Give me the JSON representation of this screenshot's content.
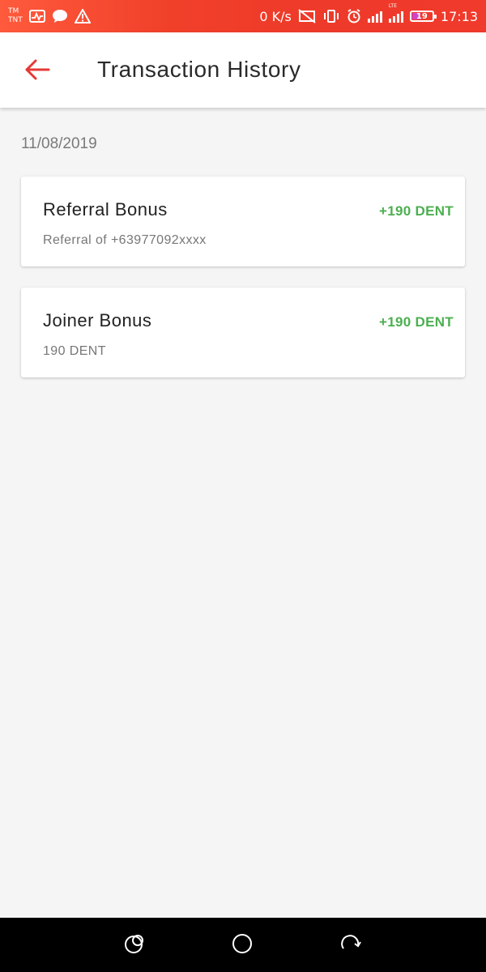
{
  "status_bar": {
    "carrier_top": "TM",
    "carrier_bottom": "TNT",
    "net_speed": "0 K/s",
    "battery_level": "19",
    "time": "17:13",
    "lte_label": "LTE",
    "icons": [
      "activity-icon",
      "chat-icon",
      "warning-icon",
      "no-sim-icon",
      "vibrate-icon",
      "alarm-icon",
      "signal-icon",
      "signal-lte-icon",
      "battery-icon"
    ]
  },
  "app_bar": {
    "title": "Transaction History",
    "back_icon": "arrow-left-icon",
    "accent_color": "#e53935"
  },
  "history": {
    "date": "11/08/2019",
    "transactions": [
      {
        "title": "Referral Bonus",
        "subtitle": "Referral of +63977092xxxx",
        "amount": "+190 DENT"
      },
      {
        "title": "Joiner Bonus",
        "subtitle": "190 DENT",
        "amount": "+190 DENT"
      }
    ],
    "amount_color": "#4caf50"
  },
  "nav_bar": {
    "icons": [
      "recent-apps-icon",
      "home-icon",
      "back-rotate-icon"
    ]
  }
}
